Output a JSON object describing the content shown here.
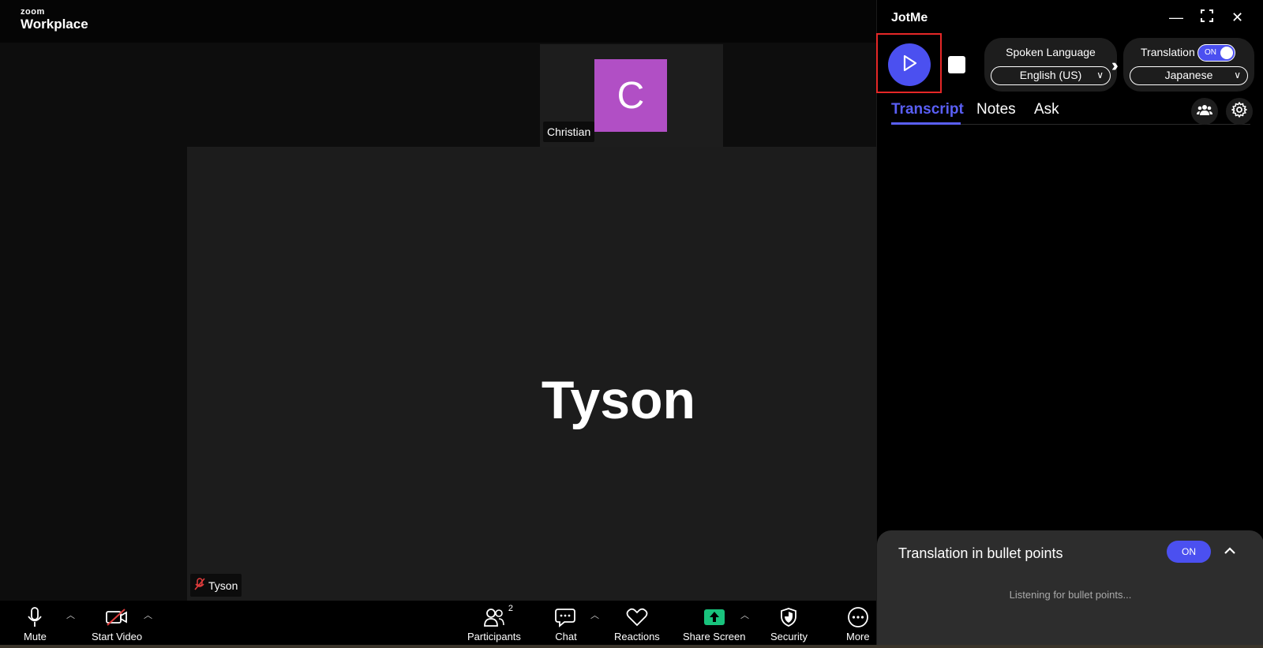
{
  "zoom": {
    "logo_small": "zoom",
    "logo_big": "Workplace"
  },
  "participants": {
    "thumb_initial": "C",
    "thumb_name": "Christian",
    "thumb_avatar_color": "#b14fc5",
    "main_name": "Tyson",
    "main_tag": "Tyson"
  },
  "toolbar": {
    "mute": "Mute",
    "start_video": "Start Video",
    "participants": "Participants",
    "participants_count": "2",
    "chat": "Chat",
    "reactions": "Reactions",
    "share_screen": "Share Screen",
    "security": "Security",
    "more": "More"
  },
  "jotme": {
    "title": "JotMe",
    "accent": "#4b50f0",
    "spoken_language_label": "Spoken Language",
    "spoken_language_value": "English (US)",
    "translation_label": "Translation",
    "translation_toggle": "ON",
    "translation_value": "Japanese",
    "tabs": [
      "Transcript",
      "Notes",
      "Ask"
    ],
    "active_tab": "Transcript",
    "bullet_title": "Translation in bullet points",
    "bullet_toggle": "ON",
    "bullet_status": "Listening for bullet points..."
  }
}
